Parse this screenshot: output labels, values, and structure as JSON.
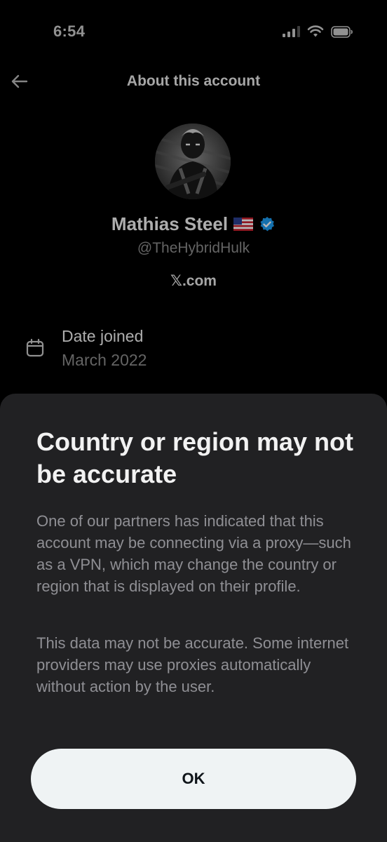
{
  "status_bar": {
    "time": "6:54",
    "icons": [
      "signal-icon",
      "wifi-icon",
      "battery-icon"
    ]
  },
  "header": {
    "back_icon": "arrow-left-icon",
    "title": "About this account"
  },
  "profile": {
    "avatar_icon": "profile-avatar",
    "display_name": "Mathias Steel",
    "flag_icon": "us-flag-icon",
    "verified_icon": "verified-badge-icon",
    "handle": "@TheHybridHulk",
    "site": "𝕏.com"
  },
  "details": {
    "date_joined_icon": "calendar-icon",
    "date_joined_label": "Date joined",
    "date_joined_value": "March 2022"
  },
  "sheet": {
    "title": "Country or region may not be accurate",
    "body_1": "One of our partners has indicated that this account may be connecting via a proxy—such as a VPN, which may change the country or region that is displayed on their profile.",
    "body_2": "This data may not be accurate. Some internet providers may use proxies automatically without action by the user.",
    "ok_label": "OK"
  },
  "colors": {
    "background": "#000000",
    "sheet_background": "#212123",
    "button_background": "#eff3f4",
    "verified_blue": "#1d9bf0",
    "muted_text": "#8f8f94"
  }
}
